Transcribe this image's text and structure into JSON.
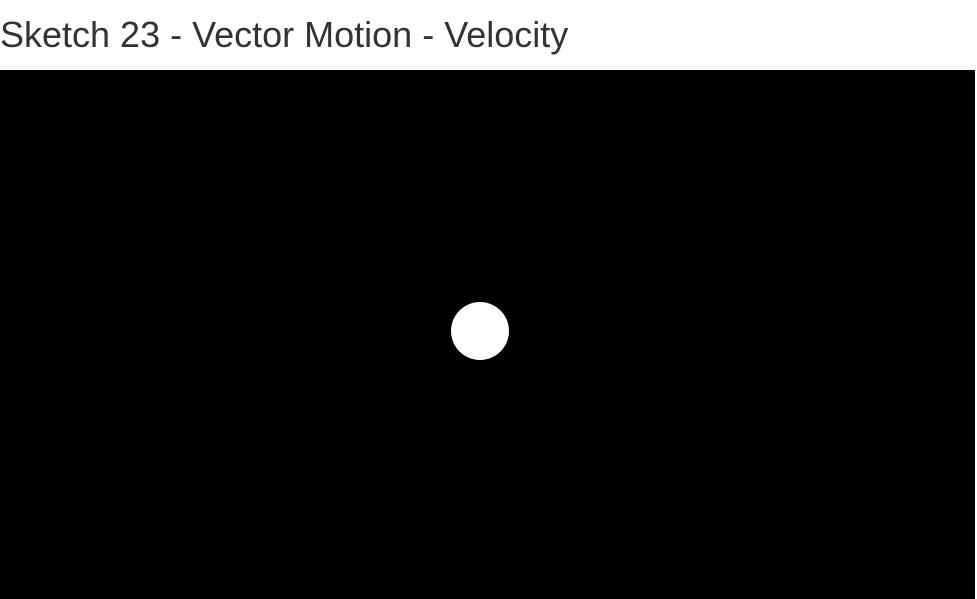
{
  "page": {
    "title": "Sketch 23 - Vector Motion - Velocity"
  },
  "sketch": {
    "background_color": "#000000",
    "ball_color": "#ffffff"
  }
}
